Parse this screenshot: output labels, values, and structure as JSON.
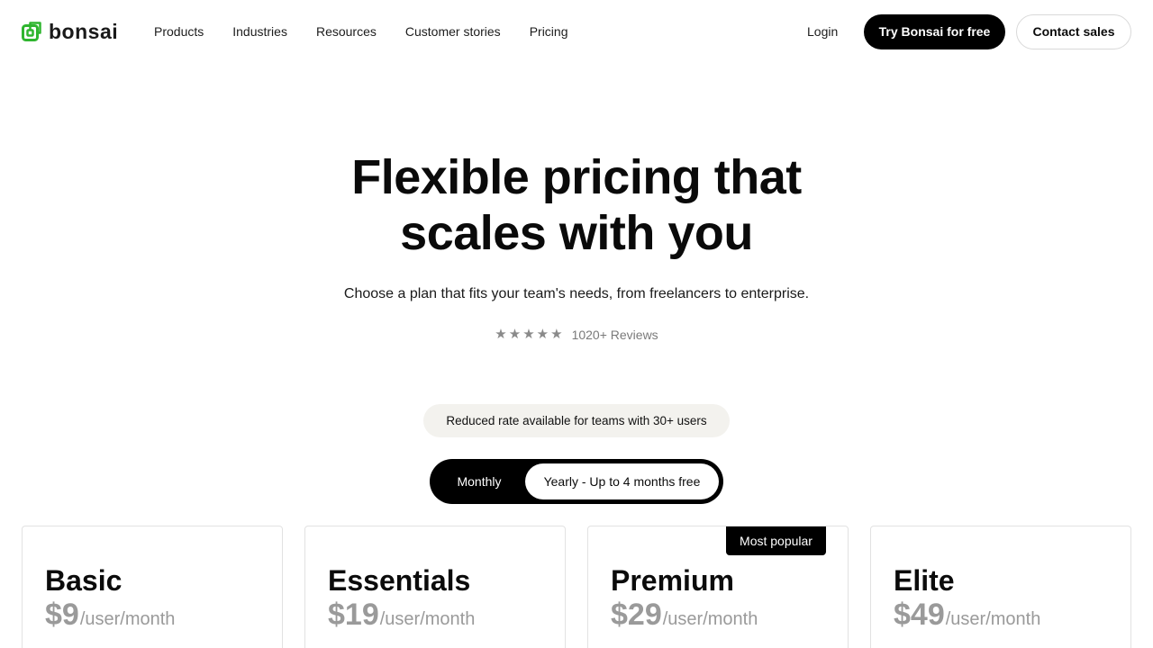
{
  "brand": {
    "name": "bonsai",
    "accent_color": "#2fb52f"
  },
  "nav": {
    "items": [
      {
        "label": "Products"
      },
      {
        "label": "Industries"
      },
      {
        "label": "Resources"
      },
      {
        "label": "Customer stories"
      },
      {
        "label": "Pricing"
      }
    ],
    "login_label": "Login",
    "primary_cta": "Try Bonsai for free",
    "secondary_cta": "Contact sales"
  },
  "hero": {
    "title_line1": "Flexible pricing that",
    "title_line2": "scales with you",
    "subtitle": "Choose a plan that fits your team's needs, from freelancers to enterprise.",
    "reviews": {
      "rating_stars": 5,
      "star_glyph": "★",
      "label": "1020+ Reviews"
    }
  },
  "discount_pill": "Reduced rate available for teams with 30+ users",
  "billing_toggle": {
    "options": [
      {
        "label": "Monthly",
        "selected": false
      },
      {
        "label": "Yearly - Up to 4 months free",
        "selected": true
      }
    ]
  },
  "plans": [
    {
      "name": "Basic",
      "price": "$9",
      "unit": "/user/month",
      "badge": ""
    },
    {
      "name": "Essentials",
      "price": "$19",
      "unit": "/user/month",
      "badge": ""
    },
    {
      "name": "Premium",
      "price": "$29",
      "unit": "/user/month",
      "badge": "Most popular"
    },
    {
      "name": "Elite",
      "price": "$49",
      "unit": "/user/month",
      "badge": ""
    }
  ]
}
